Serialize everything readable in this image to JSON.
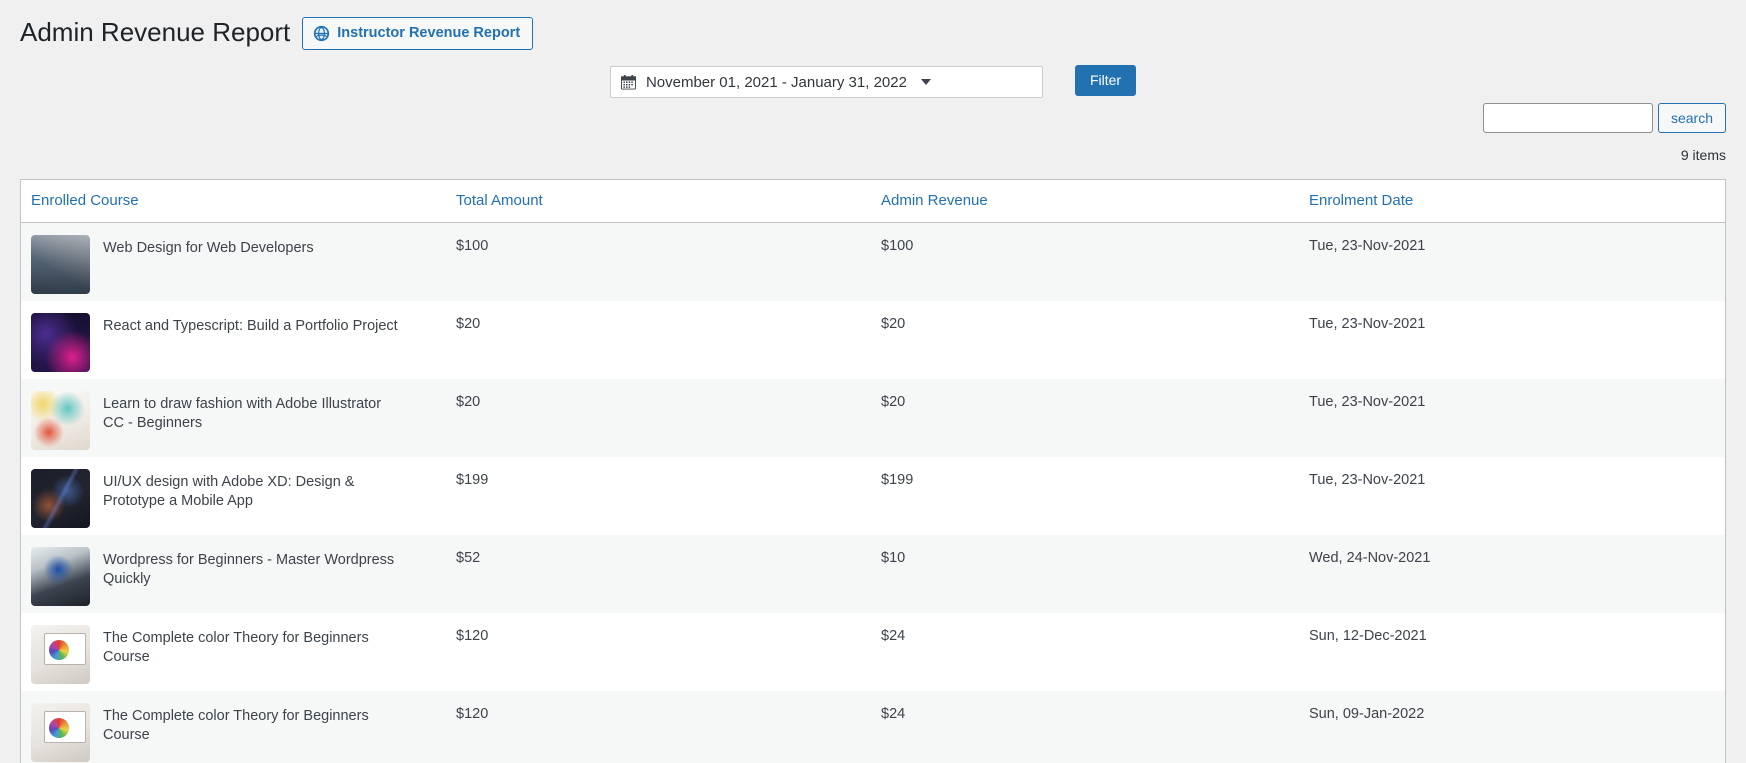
{
  "header": {
    "title": "Admin Revenue Report",
    "action_button": {
      "label": "Instructor Revenue Report",
      "icon": "globe-icon"
    }
  },
  "filter": {
    "date_range": "November 01, 2021 - January 31, 2022",
    "date_icon": "calendar-icon",
    "dropdown_icon": "chevron-down-icon",
    "filter_button_label": "Filter"
  },
  "search": {
    "value": "",
    "placeholder": "",
    "button_label": "search"
  },
  "items_count": "9 items",
  "table": {
    "columns": [
      "Enrolled Course",
      "Total Amount",
      "Admin Revenue",
      "Enrolment Date"
    ],
    "rows": [
      {
        "course": "Web Design for Web Developers",
        "total_amount": "$100",
        "admin_revenue": "$100",
        "enrolment_date": "Tue, 23-Nov-2021",
        "thumb": "t-webdev"
      },
      {
        "course": "React and Typescript: Build a Portfolio Project",
        "total_amount": "$20",
        "admin_revenue": "$20",
        "enrolment_date": "Tue, 23-Nov-2021",
        "thumb": "t-react"
      },
      {
        "course": "Learn to draw fashion with Adobe Illustrator CC - Beginners",
        "total_amount": "$20",
        "admin_revenue": "$20",
        "enrolment_date": "Tue, 23-Nov-2021",
        "thumb": "t-illustrator"
      },
      {
        "course": "UI/UX design with Adobe XD: Design & Prototype a Mobile App",
        "total_amount": "$199",
        "admin_revenue": "$199",
        "enrolment_date": "Tue, 23-Nov-2021",
        "thumb": "t-uiux"
      },
      {
        "course": "Wordpress for Beginners - Master Wordpress Quickly",
        "total_amount": "$52",
        "admin_revenue": "$10",
        "enrolment_date": "Wed, 24-Nov-2021",
        "thumb": "t-wordpress"
      },
      {
        "course": "The Complete color Theory for Beginners Course",
        "total_amount": "$120",
        "admin_revenue": "$24",
        "enrolment_date": "Sun, 12-Dec-2021",
        "thumb": "t-colortheory"
      },
      {
        "course": "The Complete color Theory for Beginners Course",
        "total_amount": "$120",
        "admin_revenue": "$24",
        "enrolment_date": "Sun, 09-Jan-2022",
        "thumb": "t-colortheory"
      }
    ]
  },
  "colors": {
    "accent": "#2271b1",
    "page_background": "#f0f0f1",
    "row_alt": "#f6f7f7",
    "border": "#c3c4c7",
    "text": "#3c434a"
  }
}
